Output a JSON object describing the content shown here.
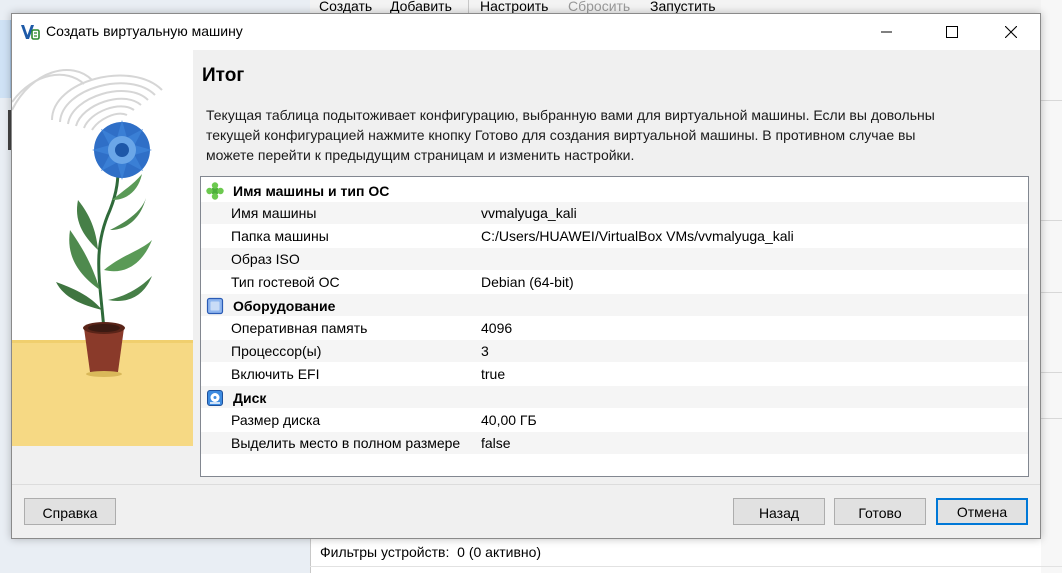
{
  "background": {
    "toolbar": [
      "Создать",
      "Добавить",
      "Настроить",
      "Сбросить",
      "Запустить"
    ],
    "partial_text": "· · · · · · · · · · · · · · ·, · · · · · · ·",
    "device_filters_label": "Фильтры устройств:",
    "device_filters_value": "0 (0 активно)"
  },
  "dialog": {
    "title": "Создать виртуальную машину",
    "heading": "Итог",
    "description": "Текущая таблица подытоживает конфигурацию, выбранную вами для виртуальной машины. Если вы довольны текущей конфигурацией нажмите кнопку Готово для создания виртуальной машины. В противном случае вы можете перейти к предыдущим страницам и изменить настройки.",
    "sections": [
      {
        "title": "Имя машины и тип ОС",
        "icon": "puzzle-icon",
        "rows": [
          {
            "key": "Имя машины",
            "value": "vvmalyuga_kali"
          },
          {
            "key": "Папка машины",
            "value": "C:/Users/HUAWEI/VirtualBox VMs/vvmalyuga_kali"
          },
          {
            "key": "Образ ISO",
            "value": ""
          },
          {
            "key": "Тип гостевой ОС",
            "value": "Debian (64-bit)"
          }
        ]
      },
      {
        "title": "Оборудование",
        "icon": "chip-icon",
        "rows": [
          {
            "key": "Оперативная память",
            "value": "4096"
          },
          {
            "key": "Процессор(ы)",
            "value": "3"
          },
          {
            "key": "Включить EFI",
            "value": "true"
          }
        ]
      },
      {
        "title": "Диск",
        "icon": "disk-icon",
        "rows": [
          {
            "key": "Размер диска",
            "value": "40,00 ГБ"
          },
          {
            "key": "Выделить место в полном размере",
            "value": "false"
          }
        ]
      }
    ],
    "buttons": {
      "help": "Справка",
      "back": "Назад",
      "finish": "Готово",
      "cancel": "Отмена"
    }
  },
  "colors": {
    "accent": "#0078d7",
    "flower": "#3a7fd5",
    "pot": "#8a3a2a",
    "floor": "#f6d984"
  }
}
